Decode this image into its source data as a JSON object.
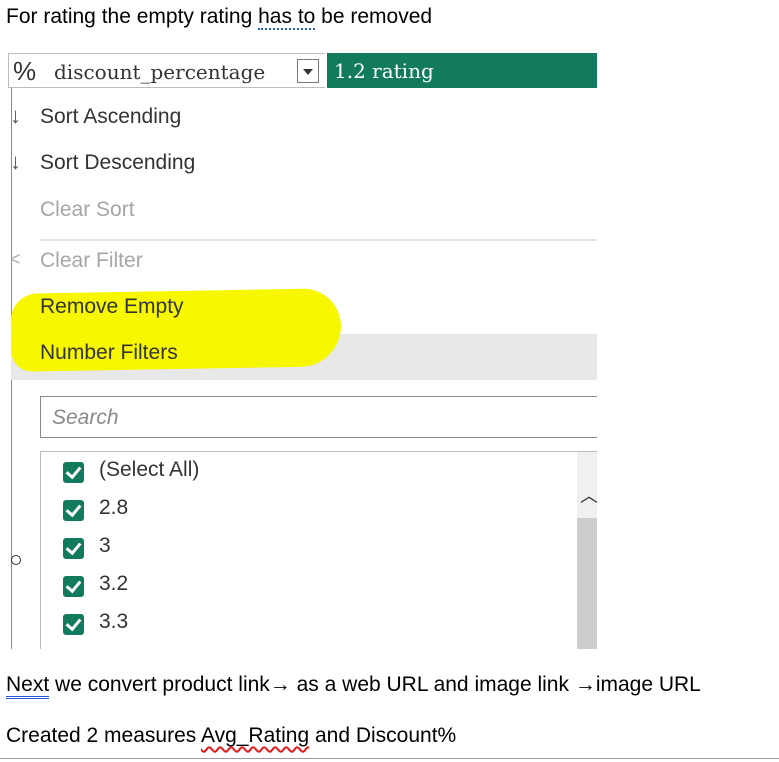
{
  "doc": {
    "line1": {
      "pre": "For rating the empty rating ",
      "marked": "has to",
      "post": " be removed"
    },
    "line2": {
      "marked": "Next",
      "post": " we convert product link→ as a web URL and image link →image URL"
    },
    "line3": {
      "pre": "Created 2 measures ",
      "marked": "Avg_Rating",
      "post": " and Discount%"
    }
  },
  "header": {
    "left_icon": "%",
    "left_label": "discount_percentage",
    "right_label": "1.2  rating",
    "accent_color": "#127b5d"
  },
  "menu": {
    "sort_ascending": "Sort Ascending",
    "sort_descending": "Sort Descending",
    "clear_sort": "Clear Sort",
    "clear_filter": "Clear Filter",
    "remove_empty": "Remove Empty",
    "number_filters": "Number Filters",
    "highlight_color": "#f7f700"
  },
  "search": {
    "placeholder": "Search"
  },
  "list": {
    "items": [
      {
        "label": "(Select All)",
        "checked": true
      },
      {
        "label": "2.8",
        "checked": true
      },
      {
        "label": "3",
        "checked": true
      },
      {
        "label": "3.2",
        "checked": true
      },
      {
        "label": "3.3",
        "checked": true
      }
    ]
  }
}
